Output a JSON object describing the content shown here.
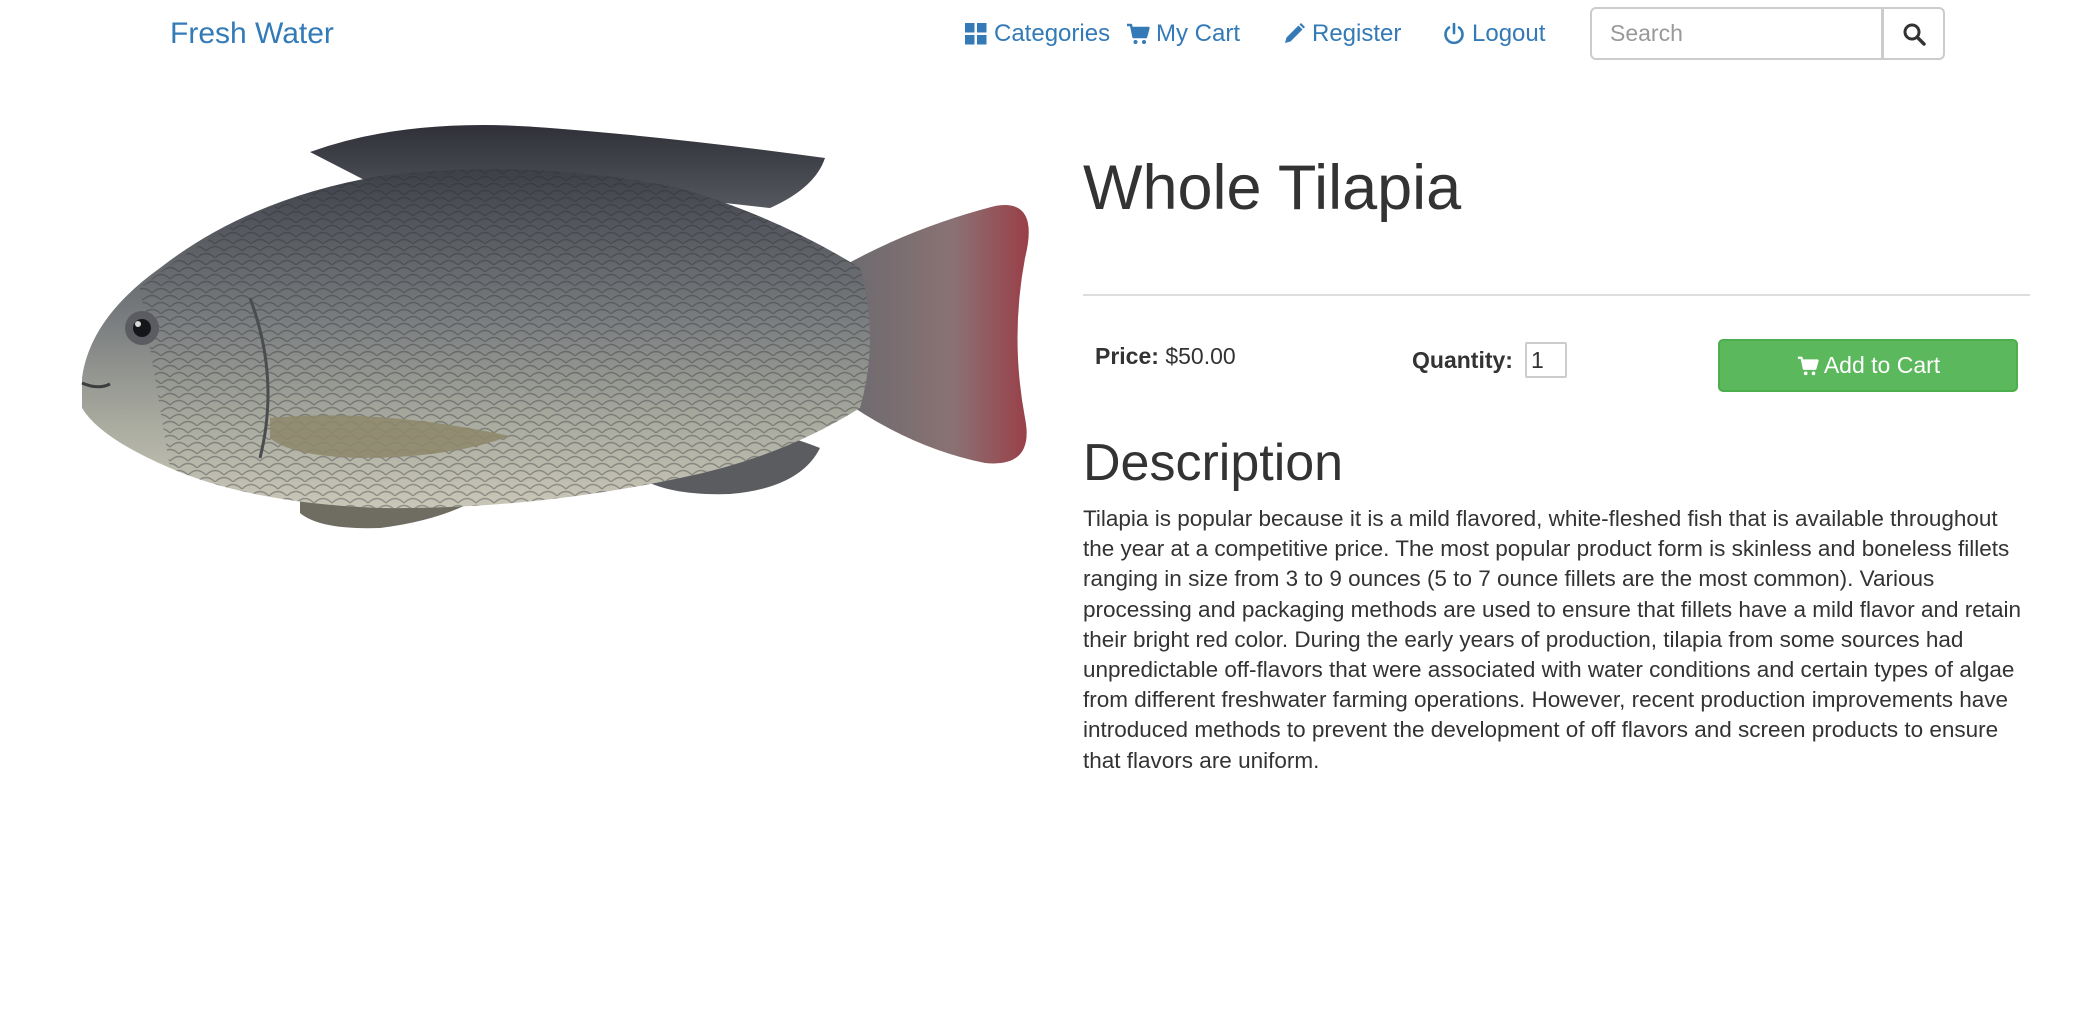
{
  "navbar": {
    "brand": "Fresh Water",
    "links": {
      "categories": "Categories",
      "cart": "My Cart",
      "register": "Register",
      "logout": "Logout"
    },
    "search": {
      "placeholder": "Search",
      "value": ""
    },
    "icons": {
      "categories": "grid-icon",
      "cart": "cart-icon",
      "register": "pencil-icon",
      "logout": "power-icon",
      "search": "search-icon"
    },
    "link_color": "#337ab7"
  },
  "product": {
    "image_subject": "whole tilapia fish",
    "title": "Whole Tilapia",
    "price_label": "Price:",
    "price": "$50.00",
    "quantity_label": "Quantity:",
    "quantity": "1",
    "add_to_cart_label": "Add to Cart",
    "add_to_cart_color": "#5cb85c",
    "description_heading": "Description",
    "description": "Tilapia is popular because it is a mild flavored, white-fleshed fish that is available throughout the year at a competitive price. The most popular product form is skinless and boneless fillets ranging in size from 3 to 9 ounces (5 to 7 ounce fillets are the most common). Various processing and packaging methods are used to ensure that fillets have a mild flavor and retain their bright red color. During the early years of production, tilapia from some sources had unpredictable off-flavors that were associated with water conditions and certain types of algae from different freshwater farming operations. However, recent production improvements have introduced methods to prevent the development of off flavors and screen products to ensure that flavors are uniform."
  }
}
